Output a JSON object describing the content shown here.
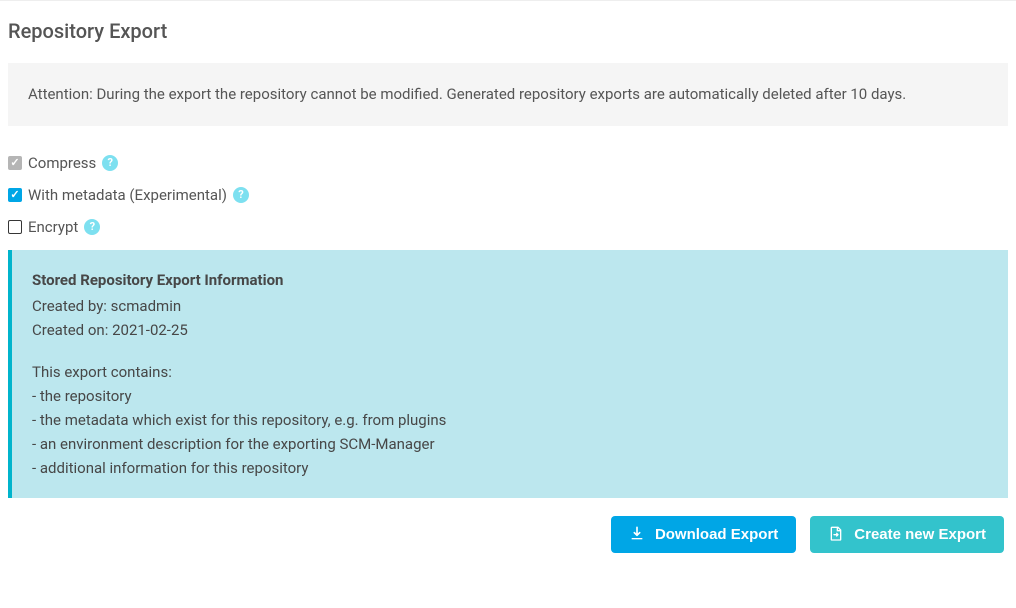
{
  "page": {
    "title": "Repository Export"
  },
  "notice": {
    "text": "Attention: During the export the repository cannot be modified. Generated repository exports are automatically deleted after 10 days."
  },
  "checkboxes": {
    "compress": {
      "label": "Compress",
      "checked": true,
      "disabled": true
    },
    "metadata": {
      "label": "With metadata (Experimental)",
      "checked": true,
      "disabled": false
    },
    "encrypt": {
      "label": "Encrypt",
      "checked": false,
      "disabled": false
    }
  },
  "info": {
    "title": "Stored Repository Export Information",
    "created_by_label": "Created by:",
    "created_by_value": "scmadmin",
    "created_on_label": "Created on:",
    "created_on_value": "2021-02-25",
    "contains_label": "This export contains:",
    "items": [
      "- the repository",
      "- the metadata which exist for this repository, e.g. from plugins",
      "- an environment description for the exporting SCM-Manager",
      "- additional information for this repository"
    ]
  },
  "buttons": {
    "download": "Download Export",
    "create": "Create new Export"
  }
}
